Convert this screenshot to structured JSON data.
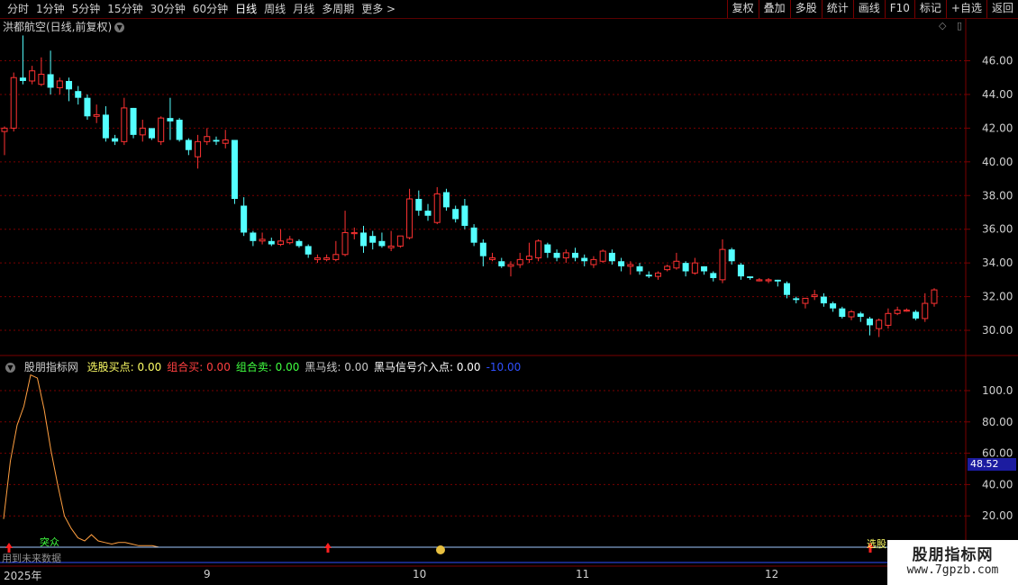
{
  "toolbar": {
    "periods": [
      "分时",
      "1分钟",
      "5分钟",
      "15分钟",
      "30分钟",
      "60分钟",
      "日线",
      "周线",
      "月线",
      "多周期",
      "更多 >"
    ],
    "active_period": "日线",
    "right_buttons": [
      "复权",
      "叠加",
      "多股",
      "统计",
      "画线",
      "F10",
      "标记",
      "+自选",
      "返回"
    ]
  },
  "main": {
    "stock_name": "洪都航空(日线,前复权)",
    "ctrl_diamond": "◇",
    "ctrl_square": "▯",
    "price_axis": [
      "46.00",
      "44.00",
      "42.00",
      "40.00",
      "38.00",
      "36.00",
      "34.00",
      "32.00",
      "30.00"
    ]
  },
  "sub": {
    "indicator_name": "股朋指标网",
    "items": [
      {
        "label": "选股买点: 0.00",
        "color": "#ffff66"
      },
      {
        "label": "组合买: 0.00",
        "color": "#ff4040"
      },
      {
        "label": "组合卖: 0.00",
        "color": "#40ff40"
      },
      {
        "label": "黑马线: 0.00",
        "color": "#c8c8c8"
      },
      {
        "label": "黑马信号介入点: 0.00",
        "color": "#ffffff"
      },
      {
        "label": "-10.00",
        "color": "#3050ff"
      }
    ],
    "axis": [
      "100.0",
      "80.00",
      "60.00",
      "40.00",
      "20.00"
    ],
    "current_value": "48.52",
    "annotations": {
      "breakout": "突众",
      "select": "选股",
      "future": "用到未来数据"
    }
  },
  "dates": {
    "year": "2025年",
    "m9": "9",
    "m10": "10",
    "m11": "11",
    "m12": "12"
  },
  "watermark": {
    "line1": "股朋指标网",
    "line2": "www.7gpzb.com"
  },
  "colors": {
    "up": "#ff3232",
    "down": "#54ffff",
    "grid": "#7a0000",
    "curve": "#ff9f40"
  },
  "chart_data": {
    "type": "candlestick",
    "title": "洪都航空(日线,前复权)",
    "ylim": [
      29.4,
      47.6
    ],
    "candles": [
      [
        41.8,
        42.0,
        40.4,
        42.1
      ],
      [
        42.0,
        45.0,
        41.8,
        45.3
      ],
      [
        45.0,
        44.8,
        44.6,
        47.5
      ],
      [
        44.8,
        45.4,
        44.6,
        45.7
      ],
      [
        44.6,
        45.2,
        44.5,
        46.2
      ],
      [
        45.2,
        44.4,
        44.0,
        46.6
      ],
      [
        44.4,
        44.8,
        44.0,
        45.0
      ],
      [
        44.8,
        44.3,
        43.6,
        45.0
      ],
      [
        44.2,
        43.8,
        43.4,
        44.5
      ],
      [
        43.8,
        42.7,
        42.5,
        44.0
      ],
      [
        42.7,
        42.8,
        42.3,
        43.4
      ],
      [
        42.8,
        41.4,
        41.2,
        43.3
      ],
      [
        41.4,
        41.2,
        41.0,
        41.6
      ],
      [
        41.2,
        43.2,
        41.0,
        43.8
      ],
      [
        43.2,
        41.6,
        41.4,
        43.2
      ],
      [
        41.6,
        42.0,
        41.2,
        42.5
      ],
      [
        42.0,
        41.4,
        41.3,
        42.0
      ],
      [
        41.2,
        42.6,
        41.0,
        42.7
      ],
      [
        42.6,
        42.4,
        41.3,
        43.8
      ],
      [
        42.5,
        41.3,
        41.2,
        42.6
      ],
      [
        41.3,
        40.7,
        40.4,
        41.4
      ],
      [
        40.3,
        41.2,
        39.6,
        41.6
      ],
      [
        41.2,
        41.5,
        41.0,
        42.0
      ],
      [
        41.3,
        41.2,
        41.0,
        41.5
      ],
      [
        41.1,
        41.3,
        40.8,
        41.9
      ],
      [
        41.3,
        37.8,
        37.5,
        41.3
      ],
      [
        37.4,
        35.8,
        35.6,
        37.9
      ],
      [
        35.8,
        35.3,
        35.0,
        35.9
      ],
      [
        35.3,
        35.4,
        35.1,
        35.8
      ],
      [
        35.3,
        35.1,
        35.0,
        35.5
      ],
      [
        35.1,
        35.3,
        35.0,
        36.0
      ],
      [
        35.2,
        35.4,
        35.1,
        35.6
      ],
      [
        35.3,
        35.0,
        34.9,
        35.4
      ],
      [
        35.0,
        34.5,
        34.3,
        35.1
      ],
      [
        34.2,
        34.3,
        34.0,
        34.5
      ],
      [
        34.2,
        34.3,
        34.1,
        34.5
      ],
      [
        34.2,
        34.5,
        34.1,
        35.3
      ],
      [
        34.5,
        35.8,
        34.4,
        37.1
      ],
      [
        35.8,
        35.8,
        35.4,
        36.1
      ],
      [
        35.8,
        35.0,
        34.6,
        36.2
      ],
      [
        35.6,
        35.2,
        34.8,
        35.9
      ],
      [
        35.3,
        35.0,
        34.9,
        35.8
      ],
      [
        34.9,
        35.0,
        34.7,
        35.9
      ],
      [
        35.0,
        35.6,
        34.9,
        35.6
      ],
      [
        35.5,
        37.8,
        35.4,
        38.4
      ],
      [
        37.8,
        37.1,
        36.8,
        38.3
      ],
      [
        37.1,
        36.8,
        36.5,
        37.5
      ],
      [
        36.4,
        38.1,
        36.3,
        38.5
      ],
      [
        38.2,
        37.3,
        37.1,
        38.4
      ],
      [
        37.2,
        36.6,
        36.4,
        37.4
      ],
      [
        37.4,
        36.2,
        36.0,
        37.8
      ],
      [
        36.1,
        35.2,
        35.0,
        36.3
      ],
      [
        35.2,
        34.4,
        33.8,
        35.4
      ],
      [
        34.2,
        34.3,
        34.1,
        34.6
      ],
      [
        34.1,
        33.8,
        33.7,
        34.3
      ],
      [
        33.8,
        33.9,
        33.2,
        34.1
      ],
      [
        33.9,
        34.2,
        33.7,
        34.6
      ],
      [
        34.2,
        34.4,
        34.0,
        35.2
      ],
      [
        34.3,
        35.3,
        34.1,
        35.4
      ],
      [
        35.1,
        34.6,
        34.3,
        35.2
      ],
      [
        34.6,
        34.3,
        34.1,
        34.8
      ],
      [
        34.3,
        34.6,
        34.0,
        34.8
      ],
      [
        34.6,
        34.3,
        34.1,
        34.9
      ],
      [
        34.3,
        34.1,
        33.8,
        34.5
      ],
      [
        33.9,
        34.2,
        33.7,
        34.4
      ],
      [
        34.1,
        34.7,
        34.0,
        34.8
      ],
      [
        34.6,
        34.1,
        33.9,
        34.8
      ],
      [
        34.1,
        33.8,
        33.5,
        34.3
      ],
      [
        33.8,
        33.9,
        33.3,
        34.1
      ],
      [
        33.8,
        33.5,
        33.3,
        34.0
      ],
      [
        33.3,
        33.2,
        33.1,
        33.5
      ],
      [
        33.2,
        33.4,
        33.0,
        33.5
      ],
      [
        33.6,
        33.8,
        33.5,
        33.9
      ],
      [
        33.7,
        34.1,
        33.6,
        34.6
      ],
      [
        34.0,
        33.5,
        33.2,
        34.1
      ],
      [
        33.4,
        34.0,
        33.3,
        34.3
      ],
      [
        33.8,
        33.5,
        33.3,
        33.8
      ],
      [
        33.4,
        33.1,
        32.9,
        33.5
      ],
      [
        33.0,
        34.8,
        32.8,
        35.4
      ],
      [
        34.8,
        34.1,
        33.9,
        34.9
      ],
      [
        33.9,
        33.2,
        33.0,
        34.0
      ],
      [
        33.2,
        33.1,
        33.0,
        33.2
      ],
      [
        33.0,
        33.0,
        32.9,
        33.1
      ],
      [
        33.0,
        33.0,
        32.8,
        33.1
      ],
      [
        33.0,
        32.9,
        32.6,
        33.0
      ],
      [
        32.8,
        32.1,
        31.9,
        32.9
      ],
      [
        31.9,
        31.8,
        31.6,
        32.0
      ],
      [
        31.6,
        31.9,
        31.3,
        31.9
      ],
      [
        32.0,
        32.1,
        31.8,
        32.4
      ],
      [
        32.0,
        31.6,
        31.4,
        32.2
      ],
      [
        31.6,
        31.3,
        31.1,
        31.7
      ],
      [
        31.3,
        30.8,
        30.7,
        31.4
      ],
      [
        30.8,
        31.1,
        30.6,
        31.2
      ],
      [
        31.0,
        30.8,
        30.5,
        31.1
      ],
      [
        30.7,
        30.3,
        29.7,
        30.8
      ],
      [
        30.1,
        30.6,
        29.6,
        30.7
      ],
      [
        30.3,
        31.0,
        30.1,
        31.3
      ],
      [
        31.0,
        31.2,
        30.9,
        31.4
      ],
      [
        31.2,
        31.2,
        31.1,
        31.3
      ],
      [
        31.1,
        30.7,
        30.6,
        31.2
      ],
      [
        30.7,
        31.6,
        30.5,
        32.2
      ],
      [
        31.6,
        32.4,
        31.4,
        32.5
      ]
    ],
    "sub_curve": [
      18,
      55,
      78,
      90,
      110,
      108,
      88,
      62,
      40,
      20,
      12,
      6,
      4,
      8,
      4,
      3,
      2,
      3,
      3,
      2,
      1,
      1,
      1,
      0
    ]
  }
}
